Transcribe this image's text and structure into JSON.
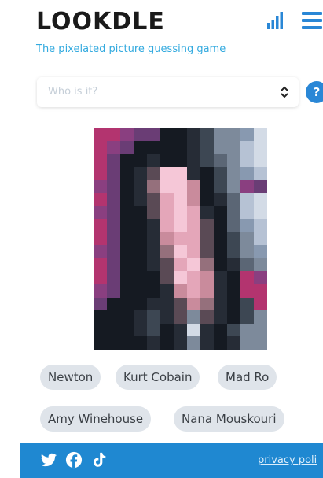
{
  "header": {
    "logo": "LOOKDLE",
    "tagline": "The pixelated picture guessing game"
  },
  "guess": {
    "placeholder": "Who is it?"
  },
  "help": {
    "label": "?"
  },
  "icons": {
    "stats": "bar-chart-icon",
    "menu": "hamburger-menu-icon",
    "select": "up-down-chevron-icon",
    "twitter": "twitter-icon",
    "facebook": "facebook-icon",
    "tiktok": "tiktok-icon"
  },
  "colors": {
    "accent": "#2a87d6",
    "tagline": "#33aadf",
    "footer": "#1f88d1",
    "chip": "#dfe4ea"
  },
  "suggestions": [
    "Newton",
    "Kurt Cobain",
    "Mad Ro",
    "Amy Winehouse",
    "Nana Mouskouri"
  ],
  "footer": {
    "privacy": "privacy poli"
  }
}
